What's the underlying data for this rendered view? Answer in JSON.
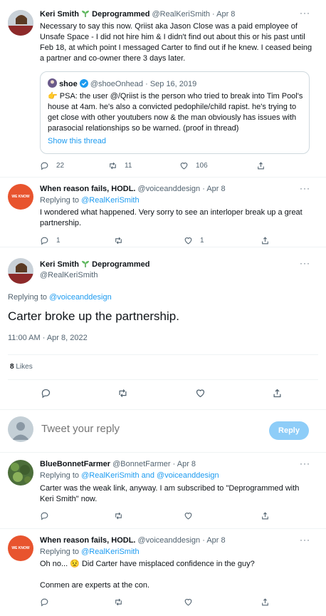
{
  "tweet1": {
    "name": "Keri Smith",
    "name_suffix": "Deprogrammed",
    "handle_date": "@RealKeriSmith · Apr 8",
    "text": "Necessary to say this now. Qriist aka Jason Close was a paid employee of Unsafe Space - I did not hire him & I didn't find out about this or his past until Feb 18, at which point I messaged Carter to find out if he knew. I ceased being a partner and co-owner there 3 days later.",
    "quote": {
      "name": "shoe",
      "handle_date": "@shoeOnhead · Sep 16, 2019",
      "emoji": "👉",
      "text": "PSA: the user @/Qriist is the person who tried to break into Tim Pool's house at 4am. he's also a convicted pedophile/child rapist. he's trying to get close with other youtubers now & the man obviously has issues with parasocial relationships so be warned. (proof in thread)",
      "show_thread": "Show this thread"
    },
    "replies": "22",
    "retweets": "11",
    "likes": "106"
  },
  "tweet2": {
    "name": "When reason fails, HODL.",
    "handle_date": "@voiceanddesign · Apr 8",
    "replying_prefix": "Replying to ",
    "replying_to": "@RealKeriSmith",
    "text": "I wondered what happened. Very sorry to see an interloper break up a great partnership.",
    "replies": "1",
    "retweets": "",
    "likes": "1",
    "avatar_text": "WE KNOW"
  },
  "main": {
    "name": "Keri Smith",
    "name_suffix": "Deprogrammed",
    "handle": "@RealKeriSmith",
    "replying_prefix": "Replying to ",
    "replying_to": "@voiceanddesign",
    "text": "Carter broke up the partnership.",
    "timestamp": "11:00 AM · Apr 8, 2022",
    "likes_count": "8",
    "likes_label": "Likes"
  },
  "compose": {
    "placeholder": "Tweet your reply",
    "button": "Reply"
  },
  "tweet3": {
    "name": "BlueBonnetFarmer",
    "handle_date": "@BonnetFarmer · Apr 8",
    "replying_prefix": "Replying to ",
    "replying_to": "@RealKeriSmith and @voiceanddesign",
    "text": "Carter was the weak link, anyway.  I am subscribed to \"Deprogrammed with Keri Smith\" now."
  },
  "tweet4": {
    "name": "When reason fails, HODL.",
    "handle_date": "@voiceanddesign · Apr 8",
    "replying_prefix": "Replying to ",
    "replying_to": "@RealKeriSmith",
    "text1": "Oh no... 😟 Did Carter have misplaced confidence in the guy?",
    "text2": "Conmen are experts at the con.",
    "avatar_text": "WE KNOW"
  },
  "more_icon": "···",
  "colors": {
    "accent": "#1d9bf0",
    "muted": "#536471",
    "avatar_orange": "#e8542e"
  }
}
